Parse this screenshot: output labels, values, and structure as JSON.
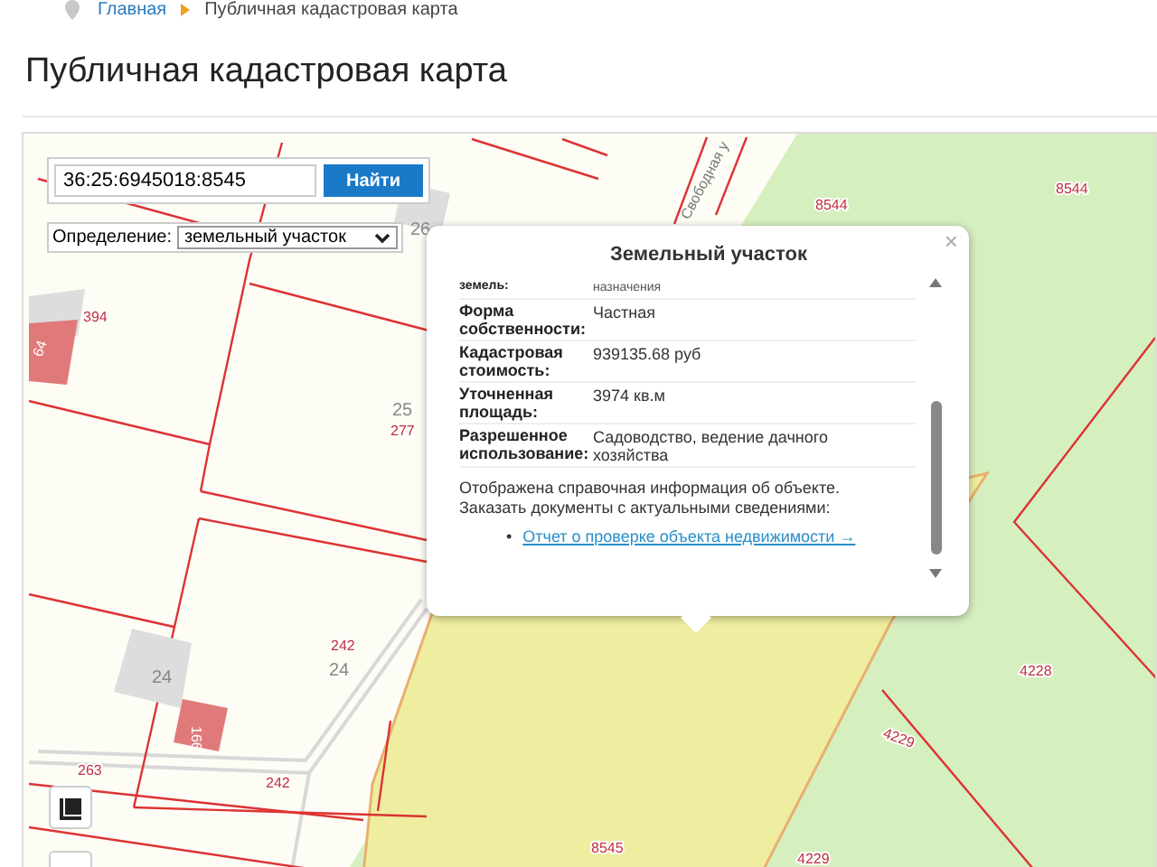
{
  "breadcrumb": [
    {
      "label": "Главная",
      "kind": "link"
    },
    {
      "label": "Публичная кадастровая карта",
      "kind": "current"
    }
  ],
  "title": "Публичная кадастровая карта",
  "search": {
    "value": "36:25:6945018:8545",
    "button": "Найти"
  },
  "definition": {
    "label": "Определение:",
    "value": "земельный участок"
  },
  "map": {
    "street": "Свободная у",
    "labels": [
      {
        "text": "8544",
        "kind": "parcel"
      },
      {
        "text": "8544",
        "kind": "parcel"
      },
      {
        "text": "26",
        "kind": "block"
      },
      {
        "text": "394",
        "kind": "parcel"
      },
      {
        "text": "64",
        "kind": "building"
      },
      {
        "text": "25",
        "kind": "block"
      },
      {
        "text": "277",
        "kind": "parcel"
      },
      {
        "text": "242",
        "kind": "parcel"
      },
      {
        "text": "24",
        "kind": "block"
      },
      {
        "text": "24",
        "kind": "block"
      },
      {
        "text": "166",
        "kind": "building"
      },
      {
        "text": "263",
        "kind": "parcel"
      },
      {
        "text": "242",
        "kind": "parcel"
      },
      {
        "text": "4228",
        "kind": "parcel"
      },
      {
        "text": "4229",
        "kind": "parcel"
      },
      {
        "text": "4229",
        "kind": "parcel"
      },
      {
        "text": "8545",
        "kind": "parcel"
      }
    ]
  },
  "popup": {
    "title": "Земельный участок",
    "close": "×",
    "rows": [
      {
        "label": "земель:",
        "value": "назначения"
      },
      {
        "label": "Форма собственности:",
        "value": "Частная"
      },
      {
        "label": "Кадастровая стоимость:",
        "value": "939135.68 руб"
      },
      {
        "label": "Уточненная площадь:",
        "value": "3974 кв.м"
      },
      {
        "label": "Разрешенное использование:",
        "value": "Садоводство, ведение дачного хозяйства"
      }
    ],
    "note_lines": [
      "Отображена справочная информация об объекте.",
      "Заказать документы с актуальными сведениями:"
    ],
    "links": [
      {
        "bullet": "•",
        "text": "Отчет о проверке объекта недвижимости →"
      }
    ]
  }
}
